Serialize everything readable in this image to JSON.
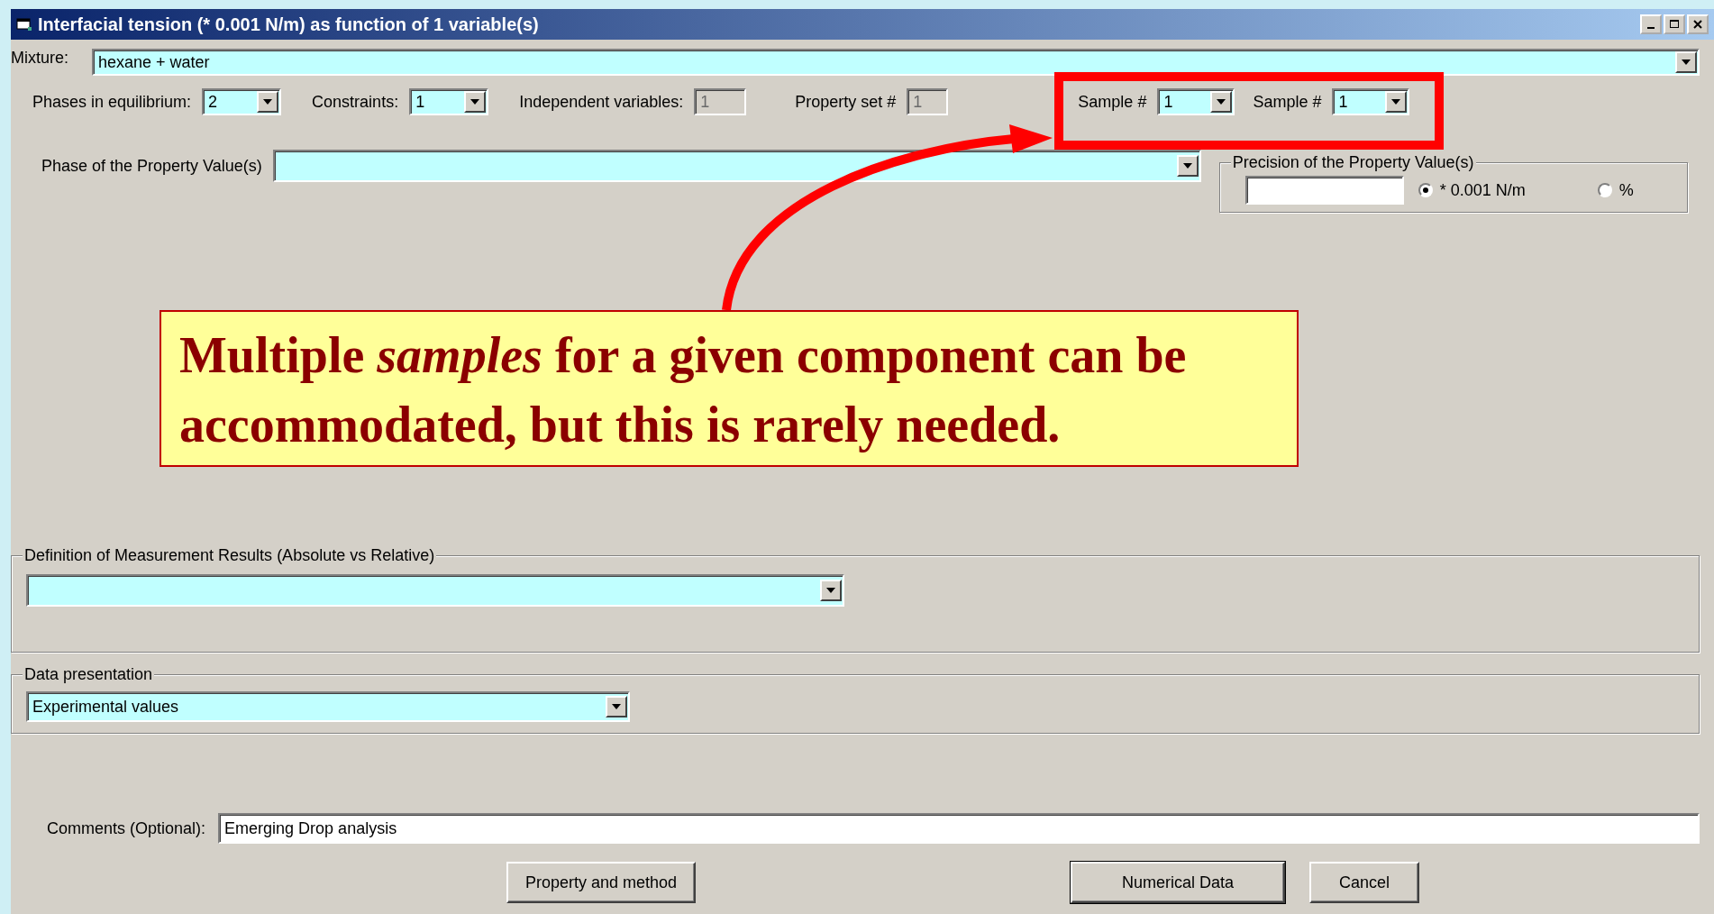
{
  "window": {
    "title": "Interfacial tension (* 0.001 N/m) as function of 1 variable(s)"
  },
  "mixture": {
    "label": "Mixture:",
    "value": "hexane + water"
  },
  "settings": [
    {
      "kind": "combo",
      "label": "Phases in equilibrium:",
      "value": "2",
      "disabled": false
    },
    {
      "kind": "combo",
      "label": "Constraints:",
      "value": "1",
      "disabled": false
    },
    {
      "kind": "field",
      "label": "Independent variables:",
      "value": "1",
      "disabled": true
    },
    {
      "kind": "field",
      "label": "Property set #",
      "value": "1",
      "disabled": true
    },
    {
      "kind": "combo",
      "label": "Sample #",
      "value": "1",
      "disabled": false
    },
    {
      "kind": "combo",
      "label": "Sample #",
      "value": "1",
      "disabled": false
    }
  ],
  "phase": {
    "label": "Phase of the Property Value(s)"
  },
  "precision": {
    "legend": "Precision of the Property Value(s)",
    "options": [
      {
        "label": "* 0.001 N/m",
        "selected": true
      },
      {
        "label": "%",
        "selected": false
      }
    ]
  },
  "definition": {
    "legend": "Definition of Measurement Results (Absolute vs Relative)"
  },
  "data_presentation": {
    "legend": "Data presentation",
    "value": "Experimental values"
  },
  "comments": {
    "label": "Comments (Optional):",
    "value": "Emerging Drop analysis"
  },
  "buttons": [
    {
      "label": "Property and method",
      "default": false
    },
    {
      "label": "Numerical Data",
      "default": true
    },
    {
      "label": "Cancel",
      "default": false
    }
  ],
  "callout": {
    "text": "Multiple *samples* for a given component can be accommodated, but this is rarely needed."
  }
}
